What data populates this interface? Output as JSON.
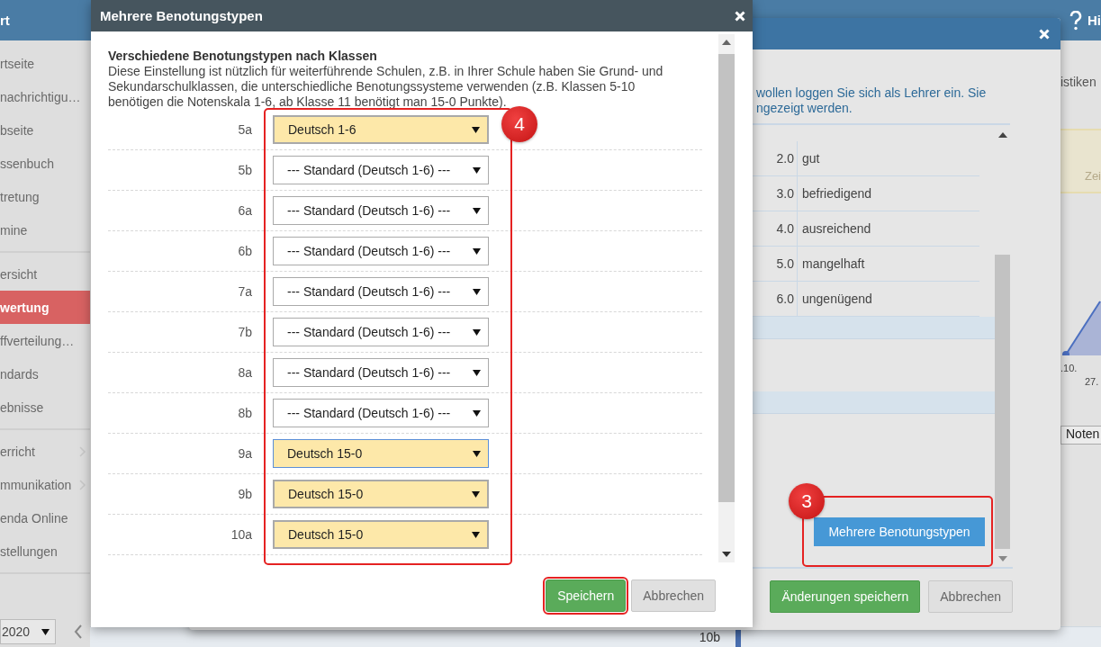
{
  "app": {
    "header_title": "rt",
    "help_label": "Hi",
    "sidebar": {
      "groups": [
        [
          {
            "label": "rtseite",
            "selected": false,
            "submenu": false
          },
          {
            "label": "nachrichtigu…",
            "selected": false,
            "submenu": false
          },
          {
            "label": "bseite",
            "selected": false,
            "submenu": false
          },
          {
            "label": "ssenbuch",
            "selected": false,
            "submenu": false
          },
          {
            "label": "tretung",
            "selected": false,
            "submenu": false
          },
          {
            "label": "mine",
            "selected": false,
            "submenu": false
          }
        ],
        [
          {
            "label": "ersicht",
            "selected": false,
            "submenu": false
          },
          {
            "label": "wertung",
            "selected": true,
            "submenu": false
          },
          {
            "label": "ffverteilung…",
            "selected": false,
            "submenu": false
          },
          {
            "label": "ndards",
            "selected": false,
            "submenu": false
          },
          {
            "label": "ebnisse",
            "selected": false,
            "submenu": false
          }
        ],
        [
          {
            "label": "erricht",
            "selected": false,
            "submenu": true
          },
          {
            "label": "mmunikation",
            "selected": false,
            "submenu": true
          },
          {
            "label": "enda Online",
            "selected": false,
            "submenu": false
          },
          {
            "label": "stellungen",
            "selected": false,
            "submenu": false
          }
        ]
      ],
      "year_select": "2020"
    },
    "peek": {
      "tab_label": "istiken",
      "panel_label": "Zei",
      "chart_labels": [
        ".10.",
        "27."
      ],
      "select_value": "Noten"
    },
    "bottom_cell": "10b"
  },
  "back_dialog": {
    "info_lines": [
      "wollen loggen Sie sich als Lehrer ein. Sie",
      "ngezeigt werden."
    ],
    "grades": [
      {
        "value": "2.0",
        "label": "gut"
      },
      {
        "value": "3.0",
        "label": "befriedigend"
      },
      {
        "value": "4.0",
        "label": "ausreichend"
      },
      {
        "value": "5.0",
        "label": "mangelhaft"
      },
      {
        "value": "6.0",
        "label": "ungenügend"
      }
    ],
    "multi_button": "Mehrere Benotungstypen",
    "step": "3",
    "buttons": [
      {
        "label": "Änderungen speichern",
        "kind": "primary"
      },
      {
        "label": "Abbrechen",
        "kind": "default"
      }
    ]
  },
  "front_dialog": {
    "title": "Mehrere Benotungstypen",
    "heading": "Verschiedene Benotungstypen nach Klassen",
    "description": "Diese Einstellung ist nützlich für weiterführende Schulen, z.B. in Ihrer Schule haben Sie Grund- und Sekundarschulklassen, die unterschiedliche Benotungssysteme verwenden (z.B. Klassen 5-10 benötigen die Notenskala 1-6, ab Klasse 11 benötigt man 15-0 Punkte).",
    "rows": [
      {
        "class": "5a",
        "value": "Deutsch 1-6",
        "custom": true,
        "focused": false
      },
      {
        "class": "5b",
        "value": "--- Standard (Deutsch 1-6) ---",
        "custom": false,
        "focused": false
      },
      {
        "class": "6a",
        "value": "--- Standard (Deutsch 1-6) ---",
        "custom": false,
        "focused": false
      },
      {
        "class": "6b",
        "value": "--- Standard (Deutsch 1-6) ---",
        "custom": false,
        "focused": false
      },
      {
        "class": "7a",
        "value": "--- Standard (Deutsch 1-6) ---",
        "custom": false,
        "focused": false
      },
      {
        "class": "7b",
        "value": "--- Standard (Deutsch 1-6) ---",
        "custom": false,
        "focused": false
      },
      {
        "class": "8a",
        "value": "--- Standard (Deutsch 1-6) ---",
        "custom": false,
        "focused": false
      },
      {
        "class": "8b",
        "value": "--- Standard (Deutsch 1-6) ---",
        "custom": false,
        "focused": false
      },
      {
        "class": "9a",
        "value": "Deutsch 15-0",
        "custom": true,
        "focused": true
      },
      {
        "class": "9b",
        "value": "Deutsch 15-0",
        "custom": true,
        "focused": false
      },
      {
        "class": "10a",
        "value": "Deutsch 15-0",
        "custom": true,
        "focused": false
      }
    ],
    "step": "4",
    "buttons": [
      {
        "label": "Speichern",
        "kind": "primary",
        "highlighted": true
      },
      {
        "label": "Abbrechen",
        "kind": "default",
        "highlighted": false
      }
    ]
  }
}
